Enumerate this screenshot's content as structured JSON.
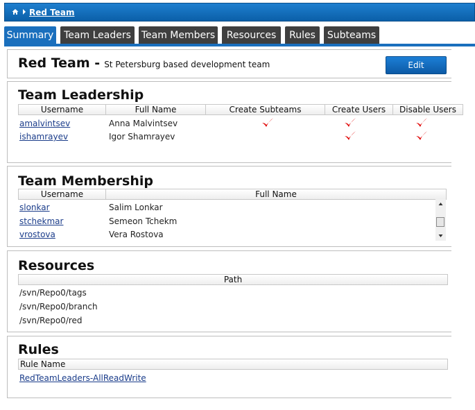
{
  "breadcrumb": {
    "home_icon": "home-icon",
    "current": "Red Team"
  },
  "tabs": [
    {
      "label": "Summary",
      "active": true
    },
    {
      "label": "Team Leaders",
      "active": false
    },
    {
      "label": "Team Members",
      "active": false
    },
    {
      "label": "Resources",
      "active": false
    },
    {
      "label": "Rules",
      "active": false
    },
    {
      "label": "Subteams",
      "active": false
    }
  ],
  "team": {
    "name": "Red Team -",
    "description": "St Petersburg based development team",
    "edit_label": "Edit"
  },
  "leadership": {
    "title": "Team Leadership",
    "columns": [
      "Username",
      "Full Name",
      "Create Subteams",
      "Create Users",
      "Disable Users"
    ],
    "rows": [
      {
        "username": "amalvintsev",
        "full_name": "Anna Malvintsev",
        "create_subteams": true,
        "create_users": true,
        "disable_users": true
      },
      {
        "username": "ishamrayev",
        "full_name": "Igor Shamrayev",
        "create_subteams": false,
        "create_users": true,
        "disable_users": true
      }
    ]
  },
  "membership": {
    "title": "Team Membership",
    "columns": [
      "Username",
      "Full Name"
    ],
    "rows": [
      {
        "username": "slonkar",
        "full_name": "Salim Lonkar"
      },
      {
        "username": "stchekmar",
        "full_name": "Semeon Tchekm"
      },
      {
        "username": "vrostova",
        "full_name": "Vera Rostova"
      }
    ]
  },
  "resources": {
    "title": "Resources",
    "columns": [
      "Path"
    ],
    "rows": [
      "/svn/Repo0/tags",
      "/svn/Repo0/branch",
      "/svn/Repo0/red"
    ]
  },
  "rules": {
    "title": "Rules",
    "columns": [
      "Rule Name"
    ],
    "rows": [
      "RedTeamLeaders-AllReadWrite"
    ]
  },
  "colors": {
    "accent": "#1a6fbd",
    "tab_inactive": "#3f3f3f",
    "check": "#e00000"
  }
}
